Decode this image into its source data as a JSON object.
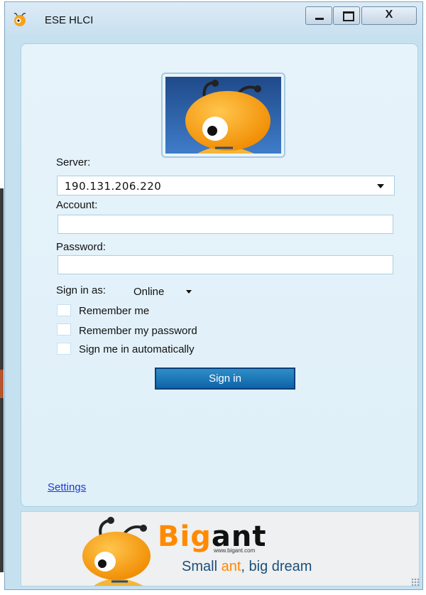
{
  "window": {
    "title": "ESE HLCI",
    "close_glyph": "X"
  },
  "icons": {
    "app": "ant-mascot-icon",
    "minimize": "minimize-icon",
    "maximize": "maximize-icon",
    "close": "close-icon",
    "dropdown": "chevron-down-icon"
  },
  "login": {
    "server_label": "Server:",
    "server_value": "190.131.206.220",
    "account_label": "Account:",
    "account_value": "",
    "password_label": "Password:",
    "password_value": "",
    "sign_in_as_label": "Sign in as:",
    "status_value": "Online",
    "checkboxes": [
      {
        "label": "Remember me",
        "checked": false
      },
      {
        "label": "Remember my password",
        "checked": false
      },
      {
        "label": "Sign me in automatically",
        "checked": false
      }
    ],
    "sign_in_button": "Sign in",
    "settings_link": "Settings"
  },
  "banner": {
    "brand_part1": "Big",
    "brand_part2": "ant",
    "url": "www.bigant.com",
    "slogan_a": "Small ",
    "slogan_b": "ant",
    "slogan_c": ", big dream"
  },
  "colors": {
    "accent": "#0d63a8",
    "brand_orange": "#ff8a00",
    "link": "#1a3ad6"
  }
}
